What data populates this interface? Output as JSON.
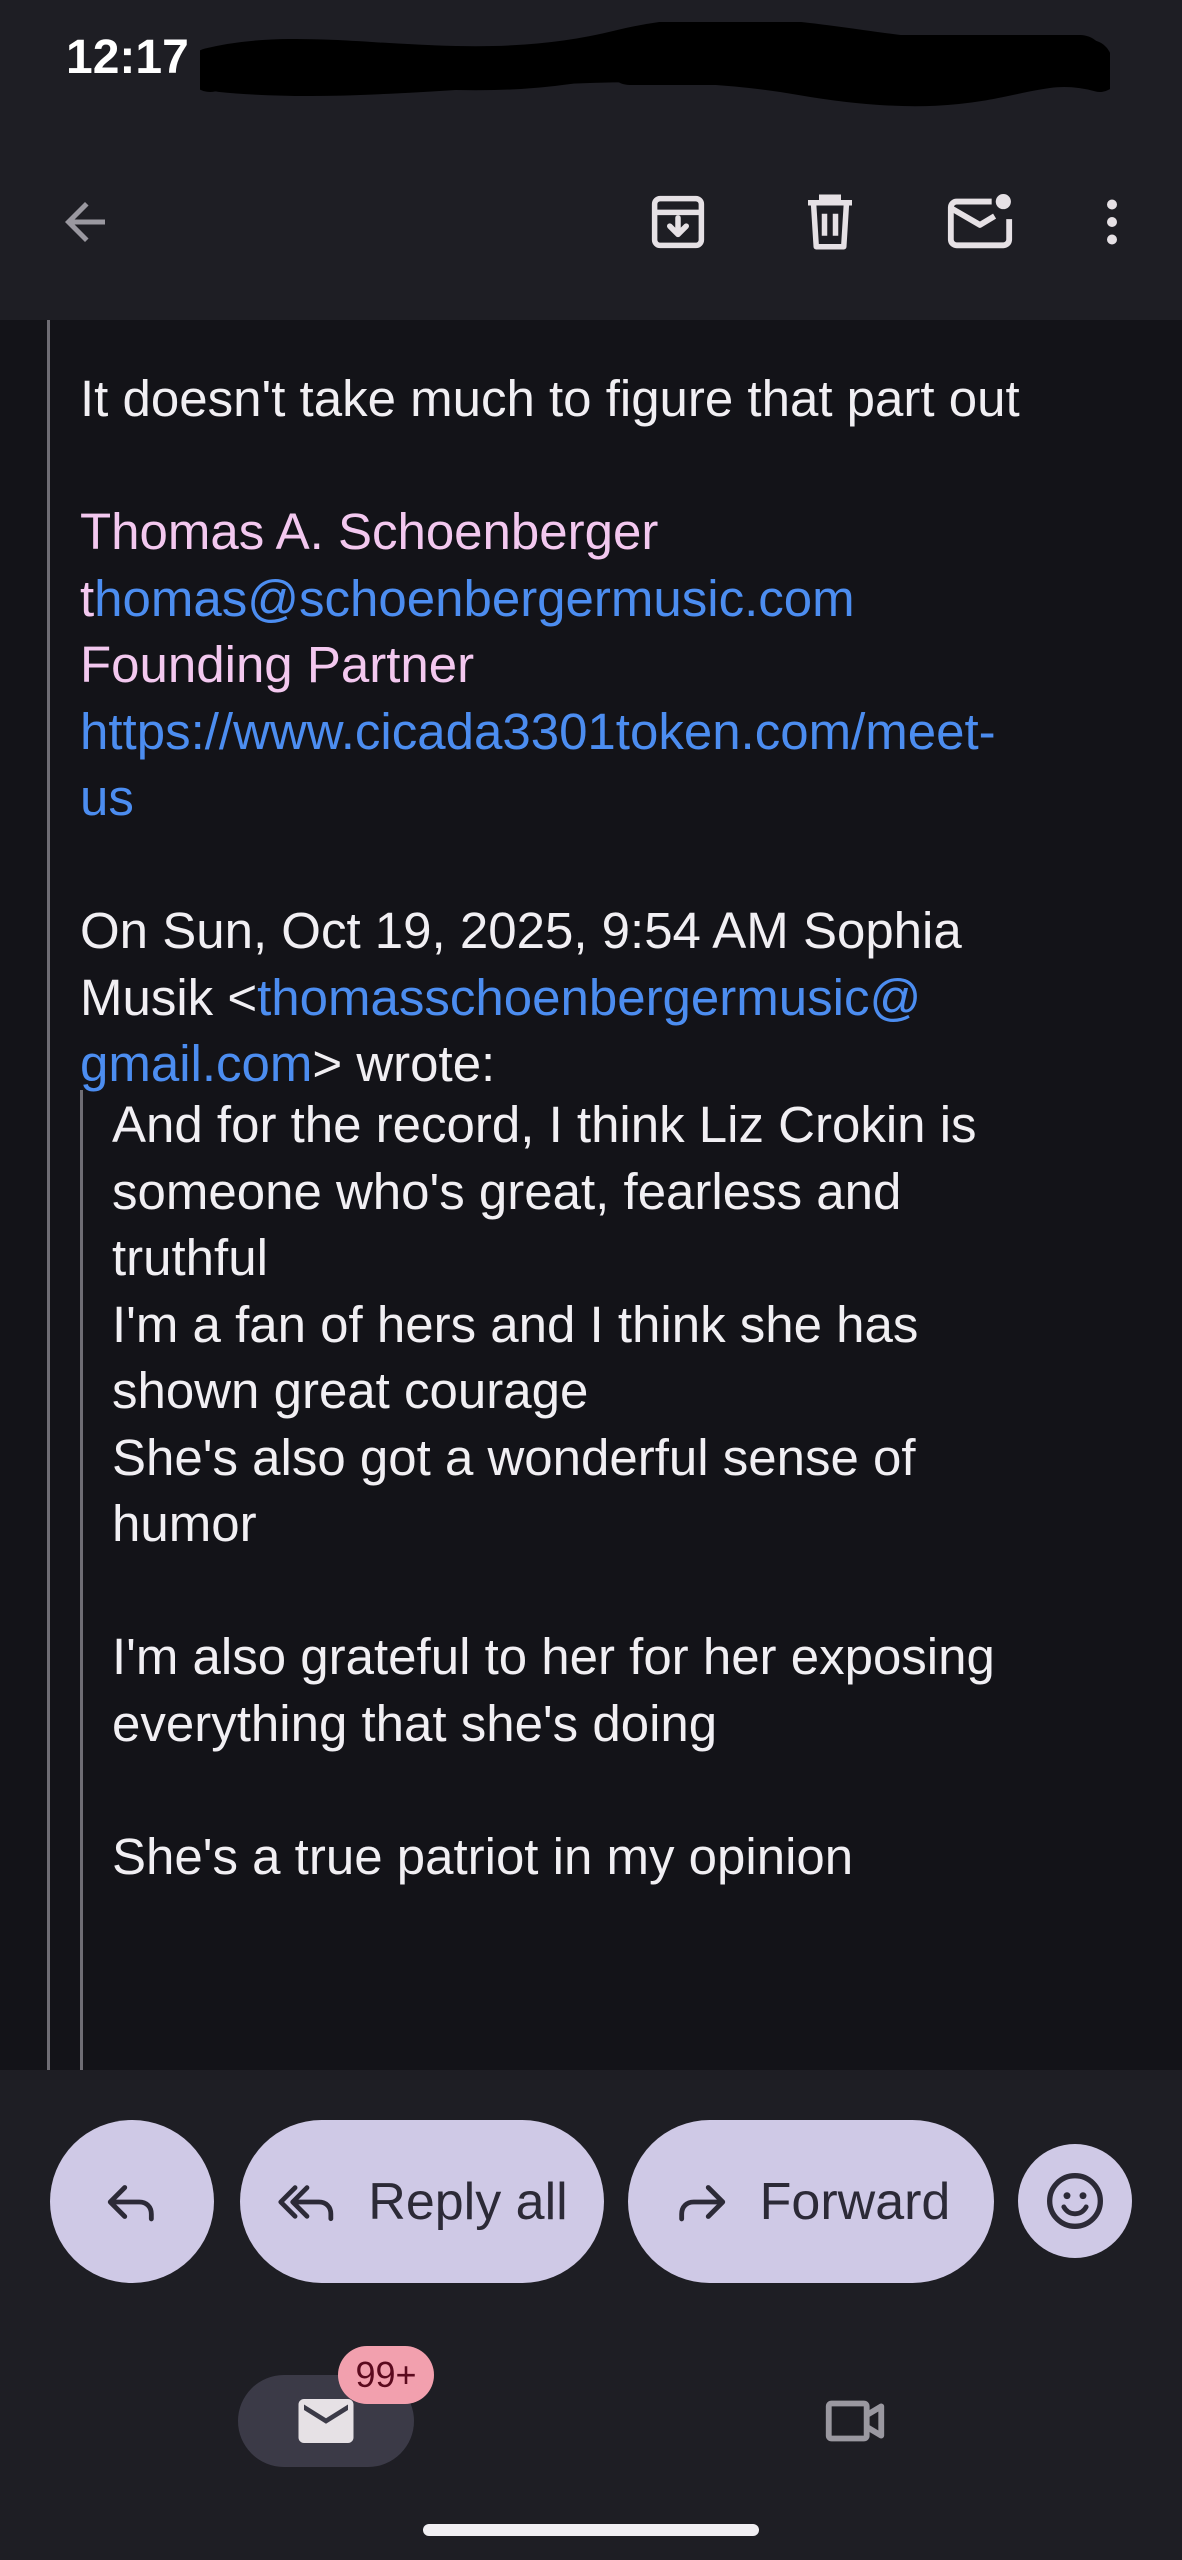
{
  "status_bar": {
    "time": "12:17"
  },
  "app_bar": {
    "back_icon": "arrow-back-icon",
    "archive_icon": "archive-icon",
    "delete_icon": "trash-icon",
    "mark_unread_icon": "mark-unread-icon",
    "more_icon": "more-vert-icon"
  },
  "message": {
    "intro_line": "It doesn't take much to figure that part out",
    "signature": {
      "name": "Thomas A. Schoenberger",
      "email_prefix": "t",
      "email_link": "homas@schoenbergermusic.com",
      "role": "Founding Partner",
      "url_line1": "https://www.cicada3301token.com/meet-",
      "url_line2": "us"
    },
    "quote_header": {
      "line1": "On Sun, Oct 19, 2025, 9:54 AM Sophia",
      "line2_prefix": "Musik <",
      "line2_link": "thomasschoenbergermusic@",
      "line3_link": "gmail.com",
      "line3_suffix": "> wrote:"
    },
    "quoted_lines": [
      "And for the record, I think Liz Crokin is",
      "someone who's great, fearless and",
      "truthful",
      "I'm a fan of hers and I think she has",
      "shown great courage",
      "She's also got a wonderful sense of",
      "humor",
      "",
      "I'm also grateful to her for her exposing",
      "everything that she's doing",
      "",
      "She's a true patriot in my opinion"
    ]
  },
  "actions": {
    "reply_icon": "reply-icon",
    "reply_all_label": "Reply all",
    "reply_all_icon": "reply-all-icon",
    "forward_label": "Forward",
    "forward_icon": "forward-icon",
    "emoji_icon": "emoji-smile-icon"
  },
  "bottom_nav": {
    "mail_icon": "mail-icon",
    "mail_badge": "99+",
    "meet_icon": "video-camera-icon"
  }
}
